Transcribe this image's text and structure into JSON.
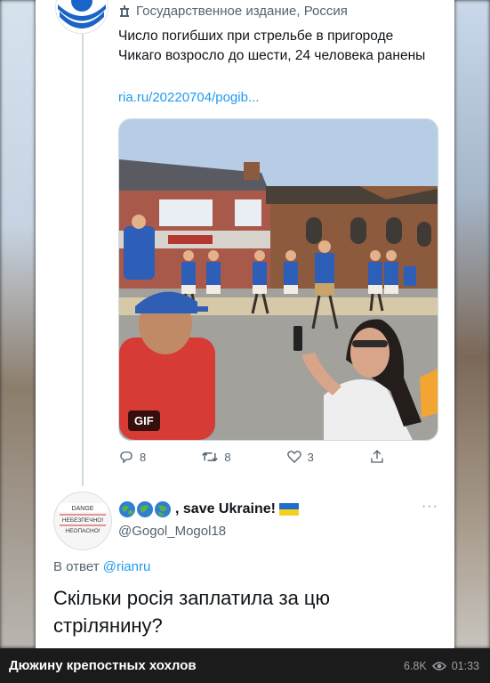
{
  "tweet": {
    "label": "Государственное издание, Россия",
    "text": "Число погибших при стрельбе в пригороде Чикаго возросло до шести, 24 человека ранены",
    "link": "ria.ru/20220704/pogib...",
    "media_badge": "GIF",
    "actions": {
      "replies": "8",
      "retweets": "8",
      "likes": "3"
    }
  },
  "reply": {
    "avatar_sign": [
      "DANGE",
      "НЕБЕЗПЕЧНО!",
      "НЕОПАСНО!"
    ],
    "name": ", save Ukraine!",
    "handle": "@Gogol_Mogol18",
    "reply_to_prefix": "В ответ",
    "reply_to_handle": "@rianru",
    "text": "Скільки росія заплатила за цю стрілянину?",
    "more": "···"
  },
  "bottom_bar": {
    "caption": "Дюжину крепостных хохлов",
    "views": "6.8K",
    "duration": "01:33"
  },
  "colors": {
    "accent": "#1d9bf0",
    "muted": "#536471",
    "text": "#0f1419",
    "bar": "#1b1b1b"
  },
  "icons": [
    "government-building-icon",
    "reply-icon",
    "retweet-icon",
    "like-icon",
    "share-icon",
    "globe-emoji-icon",
    "ukraine-flag-icon",
    "eye-icon"
  ]
}
